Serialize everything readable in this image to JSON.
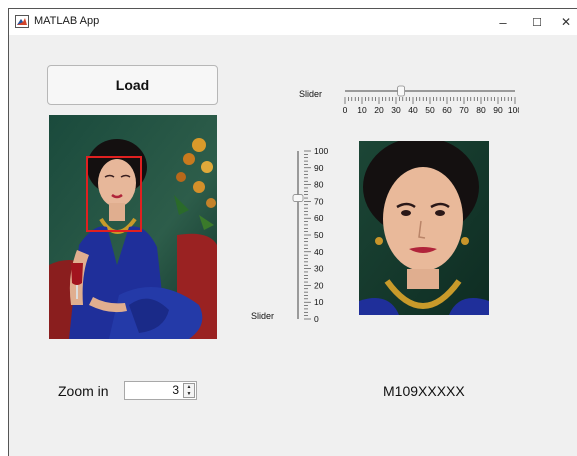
{
  "window": {
    "title": "MATLAB App",
    "minimize_glyph": "–",
    "maximize_glyph": "☐",
    "close_glyph": "✕"
  },
  "load_button": {
    "label": "Load"
  },
  "slider_horizontal": {
    "label": "Slider",
    "value": 33,
    "range": [
      0,
      100
    ],
    "major_ticks": [
      "0",
      "10",
      "20",
      "30",
      "40",
      "50",
      "60",
      "70",
      "80",
      "90",
      "100"
    ]
  },
  "slider_vertical": {
    "label": "Slider",
    "value": 72,
    "range": [
      0,
      100
    ],
    "major_ticks": [
      "0",
      "10",
      "20",
      "30",
      "40",
      "50",
      "60",
      "70",
      "80",
      "90",
      "100"
    ]
  },
  "zoom": {
    "label": "Zoom in",
    "value": "3"
  },
  "id_label": "M109XXXXX",
  "colors": {
    "window_bg": "#f0f0f0",
    "face_box": "#e02020",
    "dress": "#1f2f9a"
  },
  "icons": {
    "app": "matlab-app-icon",
    "spin_up": "spinner-up-icon",
    "spin_down": "spinner-down-icon"
  }
}
